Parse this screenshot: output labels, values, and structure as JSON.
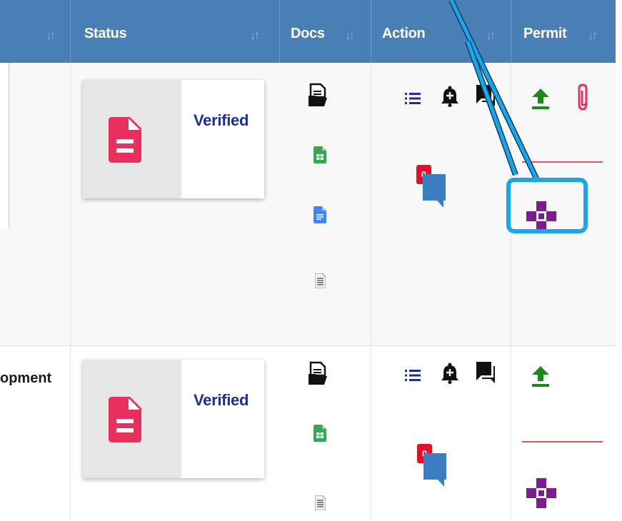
{
  "header": {
    "columns": [
      {
        "key": "first",
        "label": ""
      },
      {
        "key": "status",
        "label": "Status"
      },
      {
        "key": "docs",
        "label": "Docs"
      },
      {
        "key": "action",
        "label": "Action"
      },
      {
        "key": "permit",
        "label": "Permit"
      }
    ],
    "sort_icon": "sort-icon"
  },
  "rows": [
    {
      "first_text": "",
      "status": "Verified",
      "comment_count": "0",
      "status_icon": "pdf-document-icon",
      "docs": [
        "folder-document-icon",
        "green-sheet-icon",
        "blue-doc-icon",
        "text-doc-icon"
      ],
      "actions": [
        "list-icon",
        "bell-plus-icon",
        "chat-icon",
        "comment-count-icon"
      ],
      "permit": [
        "upload-icon",
        "paperclip-icon",
        "plus-cross-icon"
      ]
    },
    {
      "first_text": "opment",
      "status": "Verified",
      "comment_count": "0",
      "status_icon": "pdf-document-icon",
      "docs": [
        "folder-document-icon",
        "green-sheet-icon",
        "text-doc-icon"
      ],
      "actions": [
        "list-icon",
        "bell-plus-icon",
        "chat-icon",
        "comment-count-icon"
      ],
      "permit": [
        "upload-icon",
        "plus-cross-icon"
      ]
    }
  ],
  "colors": {
    "header_bg": "#4a7fb5",
    "verified_text": "#1c2f8c",
    "pdf_icon": "#e8305e",
    "upload_green": "#1e8a1e",
    "paperclip_red": "#e8305e",
    "cross_purple": "#7b1d8c",
    "annotation_cyan": "#1aa7e6",
    "badge_red": "#e0102b",
    "comment_blue": "#3a7dc1"
  }
}
